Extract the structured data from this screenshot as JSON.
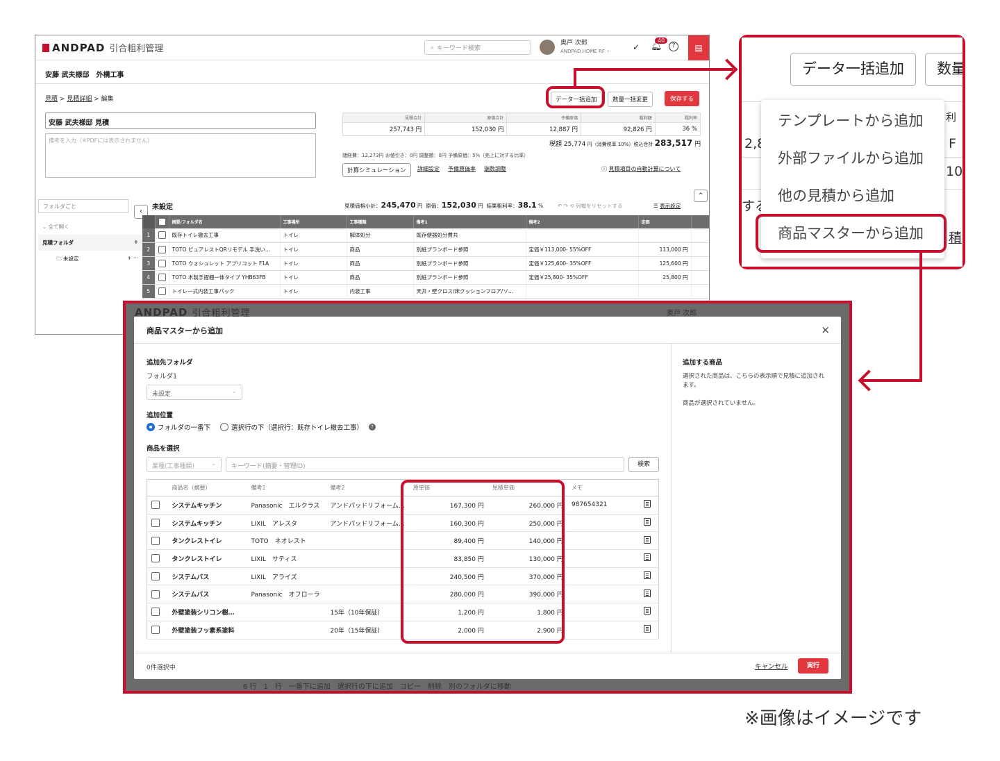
{
  "colors": {
    "accent_red": "#c8102e",
    "brand_red": "#e2373f",
    "radio_blue": "#1d6fd6"
  },
  "app": {
    "logo": "ANDPAD",
    "product": "引合粗利管理",
    "search_placeholder": "キーワード検索",
    "user_name": "奥戸 次郎",
    "user_company": "ANDPAD HOME RF ···",
    "notification_count": "40"
  },
  "back": {
    "project": "安藤 武夫様邸　外構工事",
    "breadcrumb": [
      "見積",
      "見積詳細",
      "編集"
    ],
    "buttons": {
      "bulk_add": "データ一括追加",
      "qty_change": "数量一括変更",
      "save": "保存する"
    },
    "estimate_title": "安藤 武夫様邸 見積",
    "note_placeholder": "備考を入力（※PDFには表示されません）",
    "summary_headers": [
      "見積合計",
      "原価合計",
      "予備原価",
      "粗利額",
      "粗利率"
    ],
    "summary_values": [
      "257,743 円",
      "152,030 円",
      "12,887 円",
      "92,826 円",
      "36 %"
    ],
    "tax_line_prefix": "税額 ",
    "tax_amount": "25,774",
    "tax_line_mid": " 円（消費税率 10%）税込合計 ",
    "tax_total": "283,517",
    "tax_unit": " 円",
    "misc": "諸経費：12,273円  お値引き：0円  調整額：0円  予備原価：5%（売上に対する比率）",
    "sim_button": "計算シミュレーション",
    "links": [
      "詳細設定",
      "予備原価率",
      "端数調整"
    ],
    "auto_calc_link": "見積項目の自動計算について",
    "folder_select": "フォルダごと",
    "side": {
      "open_all": "全て開く",
      "root": "見積フォルダ",
      "child": "未設定"
    },
    "section_title": "未設定",
    "subtotal_label": "見積価格小計：",
    "subtotal": "245,470",
    "cost_label": "原価：",
    "cost": "152,030",
    "margin_label": "結果粗利率：",
    "margin": "38.1",
    "yen": "円",
    "pct": "%",
    "undo_text": "列幅をリセットする",
    "display_setting": "表示設定",
    "grid_headers": [
      "摘要/フォルダ名",
      "工事場所",
      "工事種類",
      "備考1",
      "備考2",
      "定価"
    ],
    "grid_rows": [
      {
        "no": "1",
        "name": "既存トイレ撤去工事",
        "place": "トイレ",
        "type": "解体処分",
        "note1": "既存便器処分費共",
        "note2": "",
        "price": ""
      },
      {
        "no": "2",
        "name": "TOTO ピュアレストQRリモデル 手洗い…",
        "place": "トイレ",
        "type": "商品",
        "note1": "別紙プランボード参照",
        "note2": "定価￥113,000- 55%OFF",
        "price": "113,000 円"
      },
      {
        "no": "3",
        "name": "TOTO ウォシュレット アプリコット F1A",
        "place": "トイレ",
        "type": "商品",
        "note1": "別紙プランボード参照",
        "note2": "定価￥125,600- 35%OFF",
        "price": "125,600 円"
      },
      {
        "no": "4",
        "name": "TOTO 木製手摺棚一体タイプ YHB63FB",
        "place": "トイレ",
        "type": "商品",
        "note1": "別紙プランボード参照",
        "note2": "定価￥25,800- 35%OFF",
        "price": "25,800 円"
      },
      {
        "no": "5",
        "name": "トイレ一式内装工事パック",
        "place": "トイレ",
        "type": "内装工事",
        "note1": "天井・壁クロス/床クッションフロア/ソ…",
        "note2": "",
        "price": ""
      }
    ]
  },
  "zoom": {
    "bulk_add": "データ一括追加",
    "qty_partial": "数量",
    "bg_texts": [
      "利",
      "2,8",
      "F",
      "10",
      "する",
      "積"
    ],
    "menu_items": [
      "テンプレートから追加",
      "外部ファイルから追加",
      "他の見積から追加",
      "商品マスターから追加"
    ]
  },
  "modal": {
    "title": "商品マスターから追加",
    "close": "×",
    "dest_folder_label": "追加先フォルダ",
    "folder1_label": "フォルダ1",
    "folder_value": "未設定",
    "position_label": "追加位置",
    "radio_top": "フォルダの一番下",
    "radio_below": "選択行の下（選択行：既存トイレ撤去工事）",
    "select_label": "商品を選択",
    "category_placeholder": "業種(工事種類)",
    "keyword_placeholder": "キーワード(摘要・管理ID)",
    "search_button": "検索",
    "columns": [
      "商品名（摘要）",
      "備考1",
      "備考2",
      "原単価",
      "見積単価",
      "メモ"
    ],
    "rows": [
      {
        "name": "システムキッチン",
        "note1": "Panasonic　エルクラス",
        "note2": "アンドパッドリフォーム…",
        "cost": "167,300 円",
        "price": "260,000 円",
        "memo": "987654321"
      },
      {
        "name": "システムキッチン",
        "note1": "LIXIL　アレスタ",
        "note2": "アンドパッドリフォーム…",
        "cost": "160,300 円",
        "price": "250,000 円",
        "memo": ""
      },
      {
        "name": "タンクレストイレ",
        "note1": "TOTO　ネオレスト",
        "note2": "",
        "cost": "89,400 円",
        "price": "140,000 円",
        "memo": ""
      },
      {
        "name": "タンクレストイレ",
        "note1": "LIXIL　サティス",
        "note2": "",
        "cost": "83,850 円",
        "price": "130,000 円",
        "memo": ""
      },
      {
        "name": "システムバス",
        "note1": "LIXIL　アライズ",
        "note2": "",
        "cost": "240,500 円",
        "price": "370,000 円",
        "memo": ""
      },
      {
        "name": "システムバス",
        "note1": "Panasonic　オフローラ",
        "note2": "",
        "cost": "280,000 円",
        "price": "390,000 円",
        "memo": ""
      },
      {
        "name": "外壁塗装シリコン樹…",
        "note1": "",
        "note2": "15年（10年保証）",
        "cost": "1,200 円",
        "price": "1,800 円",
        "memo": ""
      },
      {
        "name": "外壁塗装フッ素系塗料",
        "note1": "",
        "note2": "20年（15年保証）",
        "cost": "2,000 円",
        "price": "2,900 円",
        "memo": ""
      }
    ],
    "right_title": "追加する商品",
    "right_desc": "選択された商品は、こちらの表示順で見積に追加されます。",
    "right_empty": "商品が選択されていません。",
    "selected_count": "0件選択中",
    "cancel": "キャンセル",
    "execute": "実行",
    "bg_bottom": "6 行　1　行　一番下に追加　選択行の下に追加　コピー　削除　別のフォルダに移動"
  },
  "footnote": "※画像はイメージです"
}
